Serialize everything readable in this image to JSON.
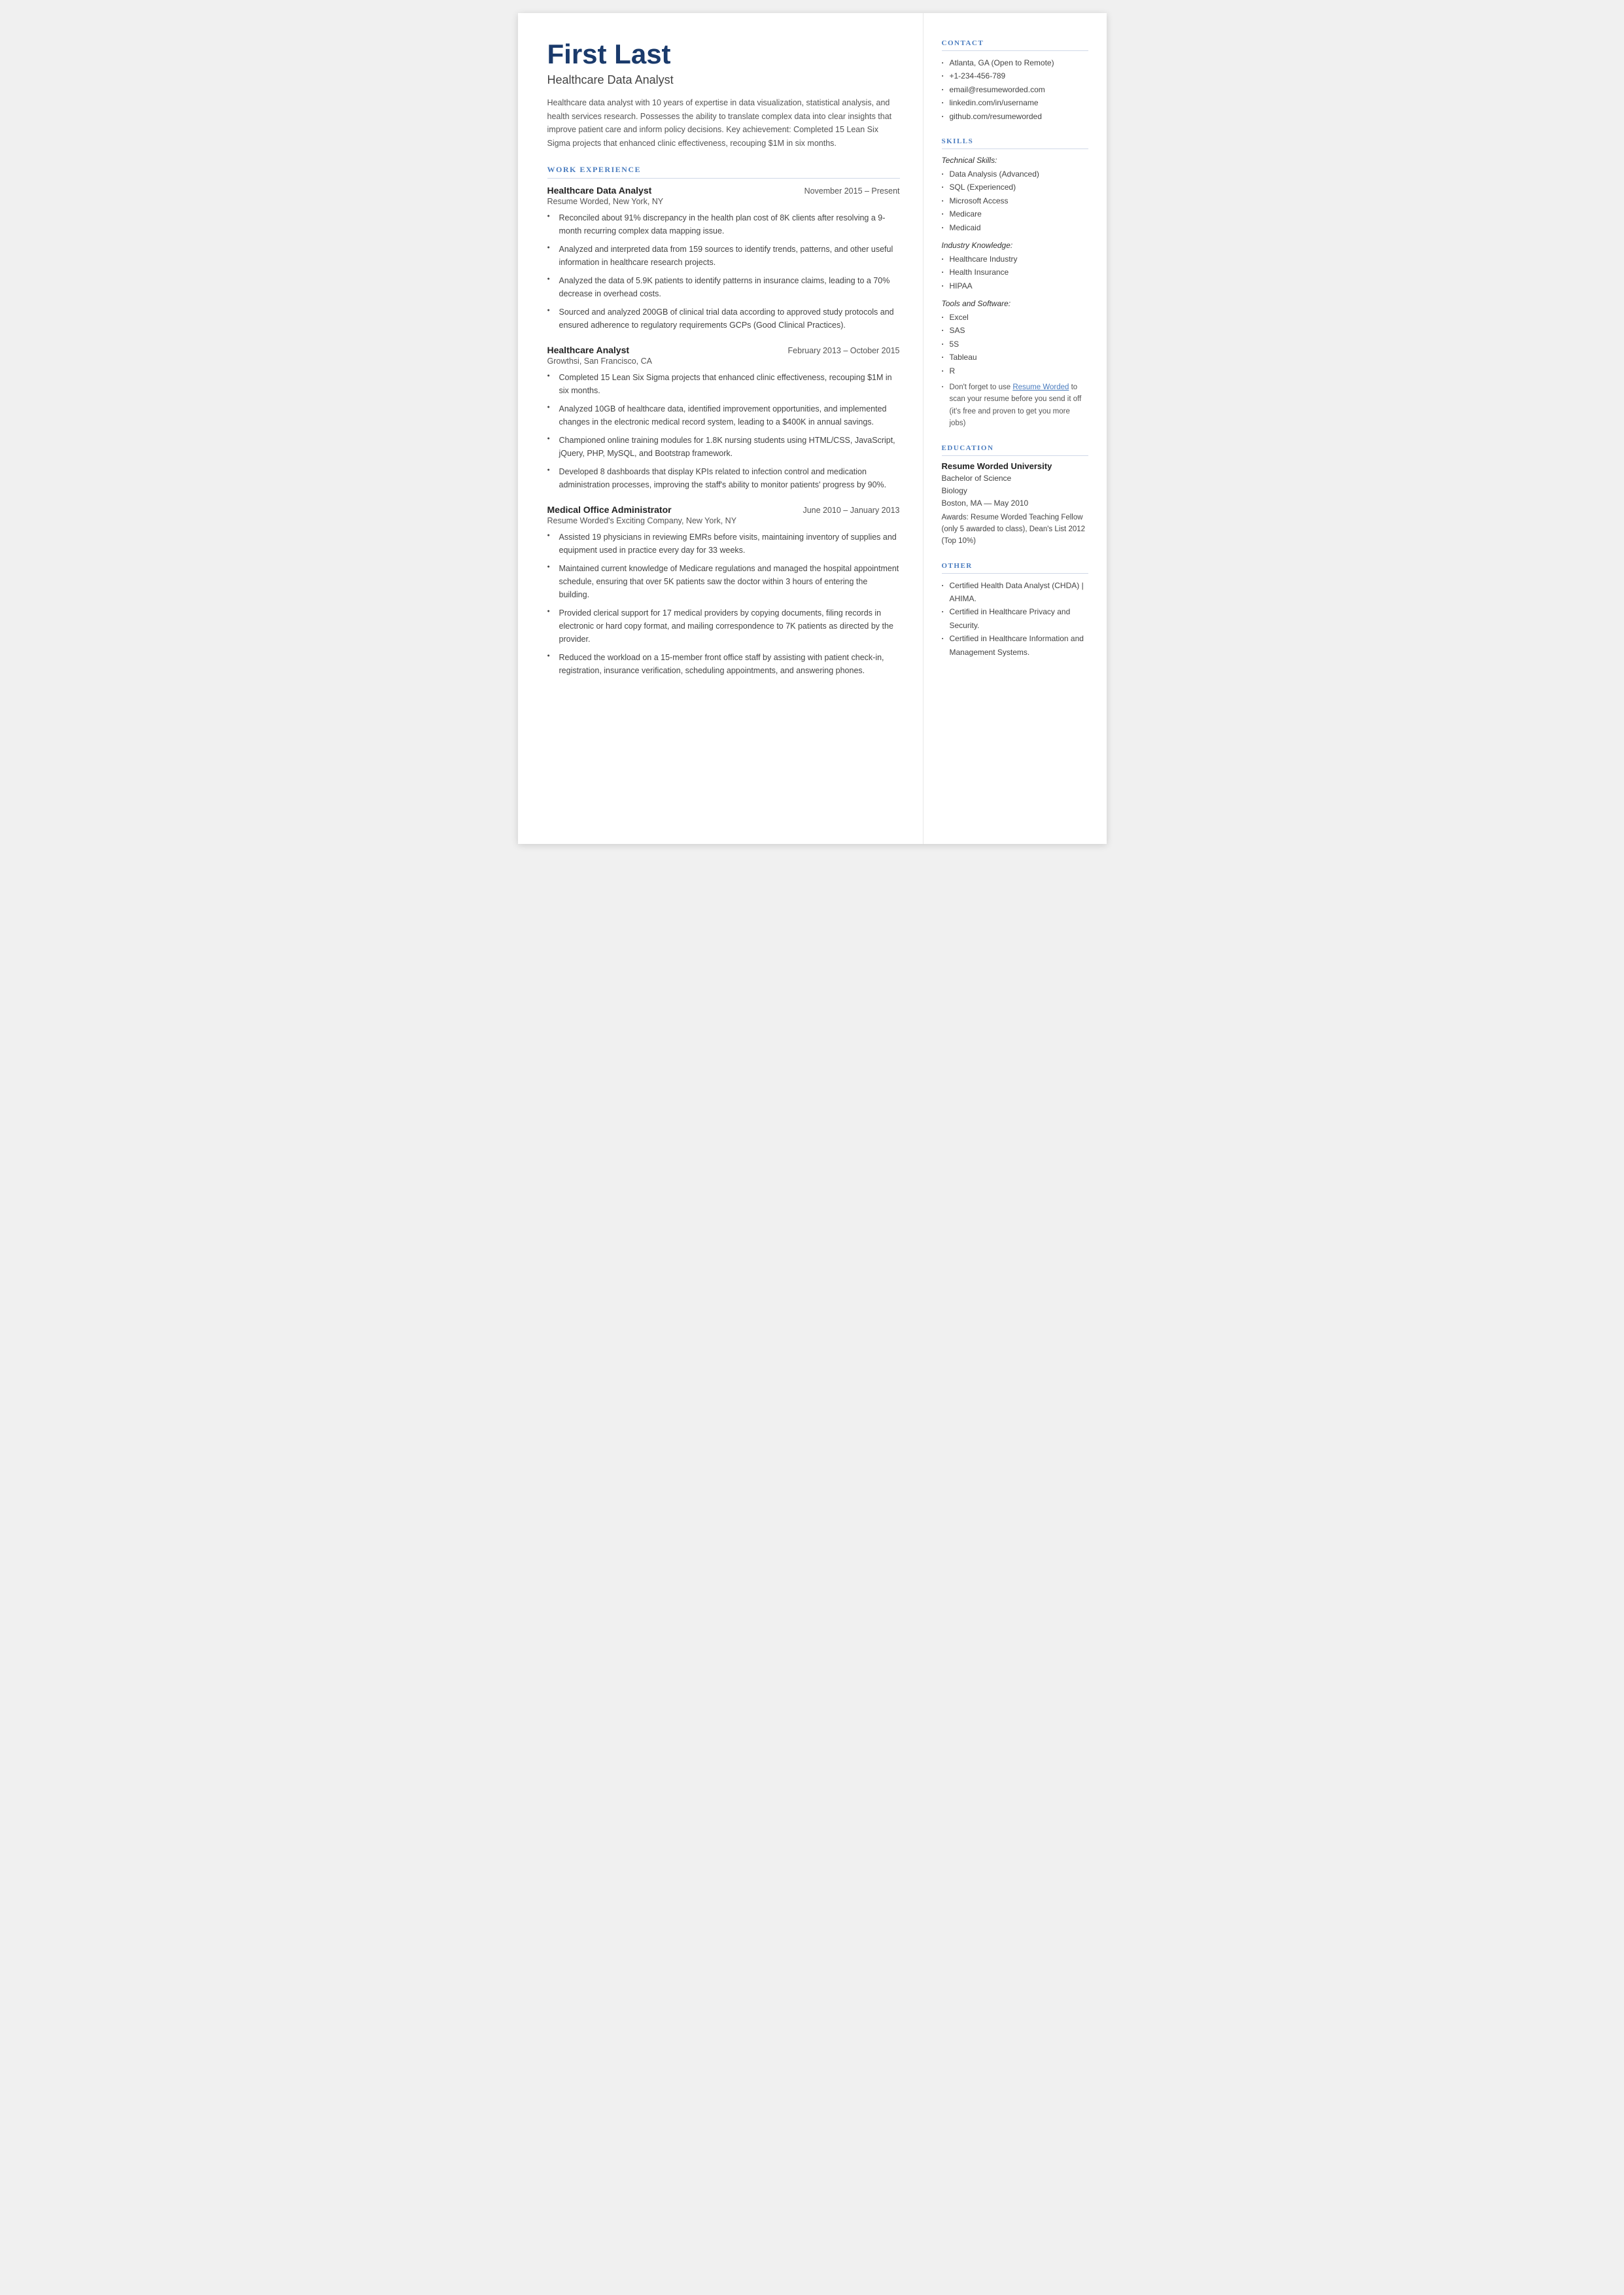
{
  "header": {
    "name": "First Last",
    "title": "Healthcare Data Analyst",
    "summary": "Healthcare data analyst with 10 years of expertise in data visualization, statistical analysis, and health services research. Possesses the ability to translate complex data into clear insights that improve patient care and inform policy decisions. Key achievement: Completed 15 Lean Six Sigma projects that enhanced clinic effectiveness, recouping $1M in six months."
  },
  "work_experience_label": "WORK EXPERIENCE",
  "jobs": [
    {
      "title": "Healthcare Data Analyst",
      "dates": "November 2015 – Present",
      "company": "Resume Worded, New York, NY",
      "bullets": [
        "Reconciled about 91% discrepancy in the health plan cost of 8K clients after resolving a 9-month recurring complex data mapping issue.",
        "Analyzed and interpreted data from 159 sources to identify trends, patterns, and other useful information in healthcare research projects.",
        "Analyzed the data of 5.9K patients to identify patterns in insurance claims, leading to a 70% decrease in overhead costs.",
        "Sourced and analyzed 200GB of clinical trial data according to approved study protocols and ensured adherence to regulatory requirements GCPs (Good Clinical Practices)."
      ]
    },
    {
      "title": "Healthcare Analyst",
      "dates": "February 2013 – October 2015",
      "company": "Growthsi, San Francisco, CA",
      "bullets": [
        "Completed 15 Lean Six Sigma projects that enhanced clinic effectiveness, recouping $1M in six months.",
        "Analyzed 10GB of healthcare data, identified improvement opportunities, and implemented changes in the electronic medical record system, leading to a $400K in annual savings.",
        "Championed online training modules for 1.8K nursing students using HTML/CSS, JavaScript, jQuery, PHP, MySQL, and Bootstrap framework.",
        "Developed 8 dashboards that display KPIs related to infection control and medication administration processes, improving the staff's ability to monitor patients' progress by 90%."
      ]
    },
    {
      "title": "Medical Office Administrator",
      "dates": "June 2010 – January 2013",
      "company": "Resume Worded's Exciting Company, New York, NY",
      "bullets": [
        "Assisted 19 physicians in reviewing EMRs before visits, maintaining inventory of supplies and equipment used in practice every day for 33 weeks.",
        "Maintained current knowledge of Medicare regulations and managed the hospital appointment schedule, ensuring that over 5K patients saw the doctor within 3 hours of entering the building.",
        "Provided clerical support for 17 medical providers by copying documents, filing records in electronic or hard copy format, and mailing correspondence to 7K patients as directed by the provider.",
        "Reduced the workload on a 15-member front office staff by assisting with patient check-in, registration, insurance verification, scheduling appointments, and answering phones."
      ]
    }
  ],
  "sidebar": {
    "contact_label": "CONTACT",
    "contact_items": [
      "Atlanta, GA (Open to Remote)",
      "+1-234-456-789",
      "email@resumeworded.com",
      "linkedin.com/in/username",
      "github.com/resumeworded"
    ],
    "skills_label": "SKILLS",
    "technical_label": "Technical Skills:",
    "technical_skills": [
      "Data Analysis (Advanced)",
      "SQL (Experienced)",
      "Microsoft Access",
      "Medicare",
      "Medicaid"
    ],
    "industry_label": "Industry Knowledge:",
    "industry_skills": [
      "Healthcare Industry",
      "Health Insurance",
      "HIPAA"
    ],
    "tools_label": "Tools and Software:",
    "tools_skills": [
      "Excel",
      "SAS",
      "5S",
      "Tableau",
      "R"
    ],
    "tip_pre": "Don't forget to use ",
    "tip_link_text": "Resume Worded",
    "tip_post": " to scan your resume before you send it off (it's free and proven to get you more jobs)",
    "education_label": "EDUCATION",
    "edu_school": "Resume Worded University",
    "edu_degree": "Bachelor of Science",
    "edu_field": "Biology",
    "edu_location_date": "Boston, MA — May 2010",
    "edu_awards": "Awards: Resume Worded Teaching Fellow (only 5 awarded to class), Dean's List 2012 (Top 10%)",
    "other_label": "OTHER",
    "other_items": [
      "Certified Health Data Analyst (CHDA) | AHIMA.",
      "Certified in Healthcare Privacy and Security.",
      "Certified in Healthcare Information and Management Systems."
    ]
  }
}
